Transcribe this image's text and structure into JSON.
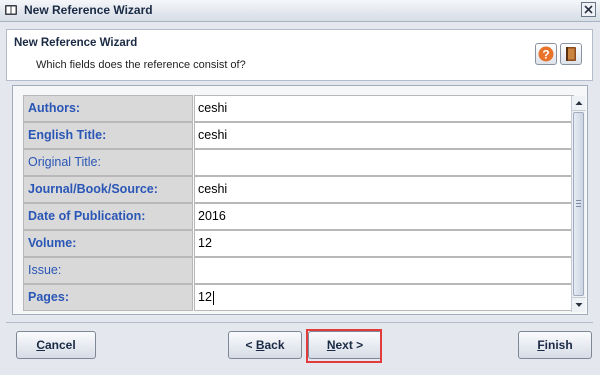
{
  "window": {
    "title": "New Reference Wizard",
    "close_symbol": "⊠"
  },
  "header": {
    "title": "New Reference Wizard",
    "subtitle": "Which fields does the reference consist of?",
    "help_icon": "question-icon",
    "book_icon": "book-icon"
  },
  "fields": [
    {
      "label": "Authors:",
      "value": "ceshi",
      "required": true
    },
    {
      "label": "English Title:",
      "value": "ceshi",
      "required": true
    },
    {
      "label": "Original Title:",
      "value": "",
      "required": false
    },
    {
      "label": "Journal/Book/Source:",
      "value": "ceshi",
      "required": true
    },
    {
      "label": "Date of Publication:",
      "value": "2016",
      "required": true
    },
    {
      "label": "Volume:",
      "value": "12",
      "required": true
    },
    {
      "label": "Issue:",
      "value": "",
      "required": false
    },
    {
      "label": "Pages:",
      "value": "12",
      "required": true
    }
  ],
  "buttons": {
    "cancel": {
      "mnemonic": "C",
      "rest": "ancel"
    },
    "back": {
      "prefix": "< ",
      "mnemonic": "B",
      "rest": "ack"
    },
    "next": {
      "mnemonic": "N",
      "rest": "ext",
      "suffix": " >"
    },
    "finish": {
      "mnemonic": "F",
      "rest": "inish"
    }
  },
  "colors": {
    "label_text": "#2a56b6",
    "highlight": "#e23b3b"
  }
}
